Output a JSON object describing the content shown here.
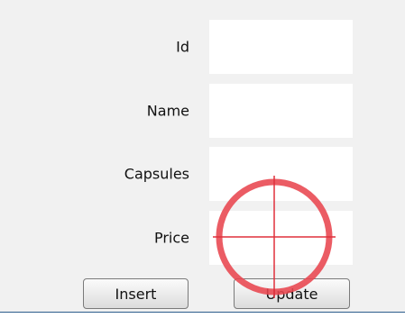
{
  "form": {
    "fields": [
      {
        "label": "Id",
        "value": ""
      },
      {
        "label": "Name",
        "value": ""
      },
      {
        "label": "Capsules",
        "value": ""
      },
      {
        "label": "Price",
        "value": ""
      }
    ]
  },
  "buttons": {
    "insert_label": "Insert",
    "update_label": "Update"
  },
  "cursor_marker": {
    "icon": "crosshair-target-icon",
    "color": "#e8454f"
  }
}
